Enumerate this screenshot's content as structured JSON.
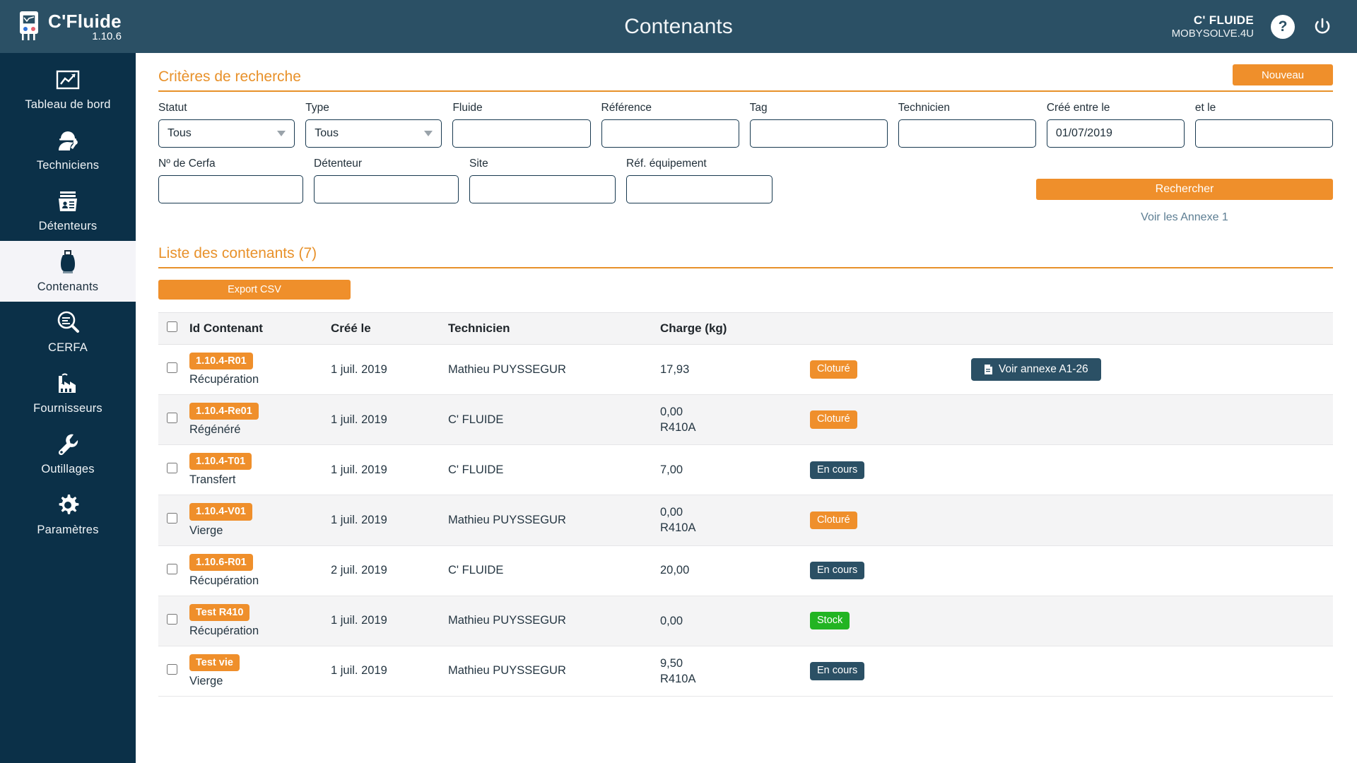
{
  "app": {
    "brand_name": "C'Fluide",
    "version": "1.10.6",
    "logo_icon": "gas-analyzer-icon",
    "title": "Contenants"
  },
  "header": {
    "account_name": "C' FLUIDE",
    "account_sub": "MOBYSOLVE.4U",
    "help_label": "?",
    "help_icon": "question-mark-icon",
    "power_icon": "power-icon"
  },
  "sidebar": {
    "items": [
      {
        "label": "Tableau de bord",
        "icon": "chart-dashboard-icon",
        "active": false
      },
      {
        "label": "Techniciens",
        "icon": "technician-worker-icon",
        "active": false
      },
      {
        "label": "Détenteurs",
        "icon": "id-card-box-icon",
        "active": false
      },
      {
        "label": "Contenants",
        "icon": "gas-cylinder-icon",
        "active": true
      },
      {
        "label": "CERFA",
        "icon": "magnifier-document-icon",
        "active": false
      },
      {
        "label": "Fournisseurs",
        "icon": "factory-icon",
        "active": false
      },
      {
        "label": "Outillages",
        "icon": "wrench-icon",
        "active": false
      },
      {
        "label": "Paramètres",
        "icon": "gear-icon",
        "active": false
      }
    ]
  },
  "search": {
    "title": "Critères de recherche",
    "new_button": "Nouveau",
    "search_button": "Rechercher",
    "annex_link": "Voir les Annexe 1",
    "fields_row1": [
      {
        "label": "Statut",
        "type": "select",
        "value": "Tous",
        "placeholder": ""
      },
      {
        "label": "Type",
        "type": "select",
        "value": "Tous",
        "placeholder": ""
      },
      {
        "label": "Fluide",
        "type": "text",
        "value": "",
        "placeholder": ""
      },
      {
        "label": "Référence",
        "type": "text",
        "value": "",
        "placeholder": ""
      },
      {
        "label": "Tag",
        "type": "text",
        "value": "",
        "placeholder": ""
      },
      {
        "label": "Technicien",
        "type": "text",
        "value": "",
        "placeholder": ""
      },
      {
        "label": "Créé entre le",
        "type": "text",
        "value": "01/07/2019",
        "placeholder": ""
      },
      {
        "label": "et le",
        "type": "text",
        "value": "",
        "placeholder": ""
      }
    ],
    "fields_row2": [
      {
        "label": "Nº de Cerfa",
        "type": "text",
        "value": "",
        "placeholder": ""
      },
      {
        "label": "Détenteur",
        "type": "text",
        "value": "",
        "placeholder": ""
      },
      {
        "label": "Site",
        "type": "text",
        "value": "",
        "placeholder": ""
      },
      {
        "label": "Réf. équipement",
        "type": "text",
        "value": "",
        "placeholder": ""
      }
    ]
  },
  "list": {
    "title": "Liste des contenants (7)",
    "export_button": "Export CSV",
    "columns": [
      "",
      "Id Contenant",
      "Créé le",
      "Technicien",
      "Charge (kg)",
      "",
      ""
    ],
    "rows": [
      {
        "id_badge": "1.10.4-R01",
        "id_sub": "Récupération",
        "created": "1 juil. 2019",
        "technician": "Mathieu PUYSSEGUR",
        "charge": "17,93",
        "fluid": "",
        "status": "Cloturé",
        "status_kind": "cloture",
        "action": "Voir annexe A1-26",
        "action_icon": "document-icon"
      },
      {
        "id_badge": "1.10.4-Re01",
        "id_sub": "Régénéré",
        "created": "1 juil. 2019",
        "technician": "C' FLUIDE",
        "charge": "0,00",
        "fluid": "R410A",
        "status": "Cloturé",
        "status_kind": "cloture",
        "action": "",
        "action_icon": ""
      },
      {
        "id_badge": "1.10.4-T01",
        "id_sub": "Transfert",
        "created": "1 juil. 2019",
        "technician": "C' FLUIDE",
        "charge": "7,00",
        "fluid": "",
        "status": "En cours",
        "status_kind": "encours",
        "action": "",
        "action_icon": ""
      },
      {
        "id_badge": "1.10.4-V01",
        "id_sub": "Vierge",
        "created": "1 juil. 2019",
        "technician": "Mathieu PUYSSEGUR",
        "charge": "0,00",
        "fluid": "R410A",
        "status": "Cloturé",
        "status_kind": "cloture",
        "action": "",
        "action_icon": ""
      },
      {
        "id_badge": "1.10.6-R01",
        "id_sub": "Récupération",
        "created": "2 juil. 2019",
        "technician": "C' FLUIDE",
        "charge": "20,00",
        "fluid": "",
        "status": "En cours",
        "status_kind": "encours",
        "action": "",
        "action_icon": ""
      },
      {
        "id_badge": "Test R410",
        "id_sub": "Récupération",
        "created": "1 juil. 2019",
        "technician": "Mathieu PUYSSEGUR",
        "charge": "0,00",
        "fluid": "",
        "status": "Stock",
        "status_kind": "stock",
        "action": "",
        "action_icon": ""
      },
      {
        "id_badge": "Test vie",
        "id_sub": "Vierge",
        "created": "1 juil. 2019",
        "technician": "Mathieu PUYSSEGUR",
        "charge": "9,50",
        "fluid": "R410A",
        "status": "En cours",
        "status_kind": "encours",
        "action": "",
        "action_icon": ""
      }
    ]
  },
  "colors": {
    "brand_dark": "#0b3048",
    "header_teal": "#2b5065",
    "accent_orange": "#ef8f2b",
    "title_orange": "#e8912a",
    "status_green": "#22b423",
    "row_alt": "#f4f4f5"
  }
}
